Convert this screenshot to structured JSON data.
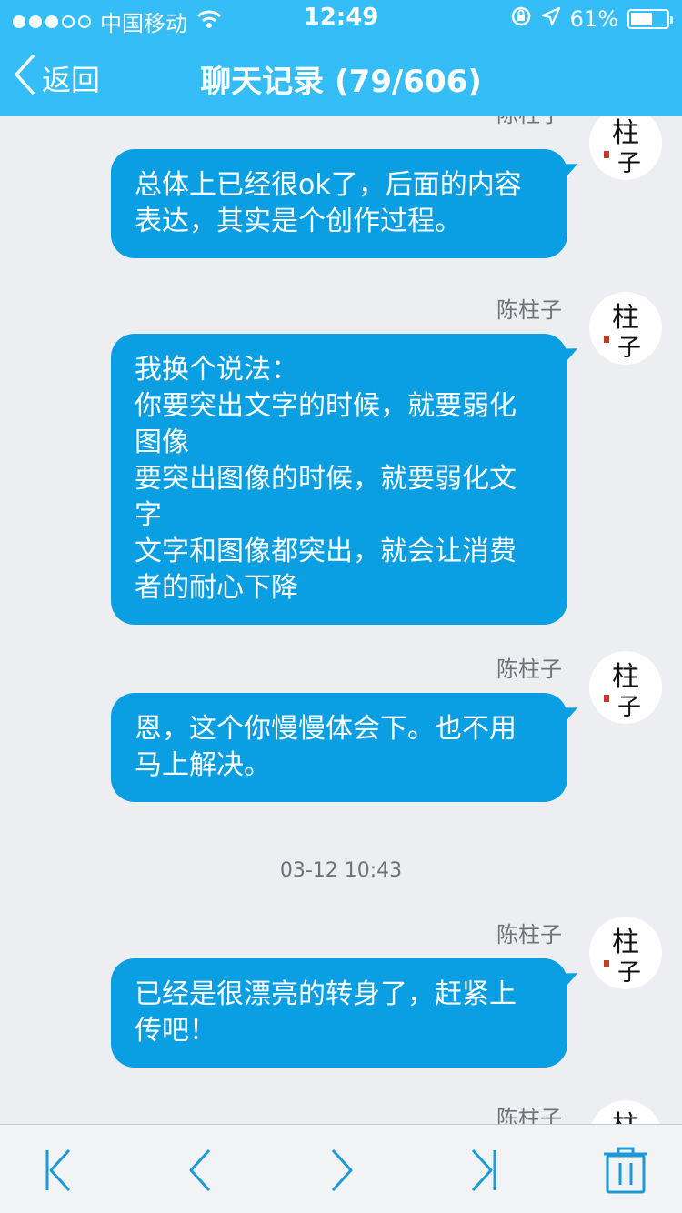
{
  "status_bar": {
    "carrier": "中国移动",
    "time": "12:49",
    "battery_percent_text": "61%",
    "battery_level": 0.61,
    "icons": [
      "signal-dots",
      "wifi-icon",
      "orientation-lock-icon",
      "location-icon",
      "battery-icon"
    ]
  },
  "nav": {
    "back_label": "返回",
    "title": "聊天记录 (79/606)"
  },
  "messages": [
    {
      "sender": "陈柱子",
      "lines": [
        "总体上已经很ok了，后面的内容",
        "表达，其实是个创作过程。"
      ]
    },
    {
      "sender": "陈柱子",
      "lines": [
        "我换个说法：",
        "你要突出文字的时候，就要弱化",
        "图像",
        "要突出图像的时候，就要弱化文",
        "字",
        "文字和图像都突出，就会让消费",
        "者的耐心下降"
      ]
    },
    {
      "sender": "陈柱子",
      "lines": [
        "恩，这个你慢慢体会下。也不用",
        "马上解决。"
      ]
    },
    {
      "timestamp": "03-12 10:43"
    },
    {
      "sender": "陈柱子",
      "lines": [
        "已经是很漂亮的转身了，赶紧上",
        "传吧！"
      ]
    },
    {
      "sender": "陈柱子"
    }
  ],
  "toolbar": {
    "buttons": [
      "first-page",
      "previous",
      "next",
      "last-page",
      "delete"
    ]
  },
  "colors": {
    "header": "#34bdf6",
    "bubble": "#0a9ee3",
    "background": "#eceef1",
    "toolbar_icon": "#1a9bd8"
  }
}
